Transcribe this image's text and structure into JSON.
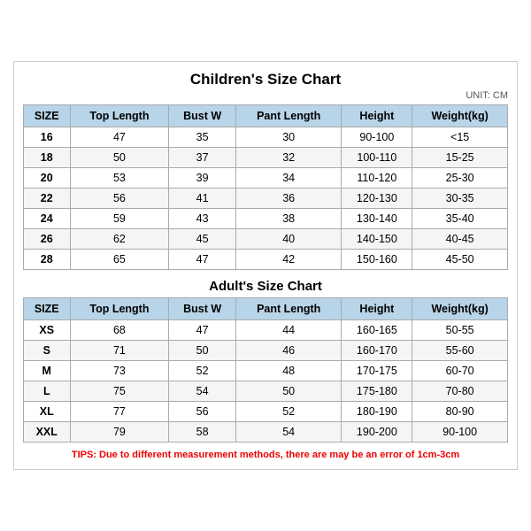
{
  "main_title": "Children's Size Chart",
  "unit": "UNIT: CM",
  "children_headers": [
    "SIZE",
    "Top Length",
    "Bust W",
    "Pant Length",
    "Height",
    "Weight(kg)"
  ],
  "children_rows": [
    [
      "16",
      "47",
      "35",
      "30",
      "90-100",
      "<15"
    ],
    [
      "18",
      "50",
      "37",
      "32",
      "100-110",
      "15-25"
    ],
    [
      "20",
      "53",
      "39",
      "34",
      "110-120",
      "25-30"
    ],
    [
      "22",
      "56",
      "41",
      "36",
      "120-130",
      "30-35"
    ],
    [
      "24",
      "59",
      "43",
      "38",
      "130-140",
      "35-40"
    ],
    [
      "26",
      "62",
      "45",
      "40",
      "140-150",
      "40-45"
    ],
    [
      "28",
      "65",
      "47",
      "42",
      "150-160",
      "45-50"
    ]
  ],
  "adult_title": "Adult's Size Chart",
  "adult_headers": [
    "SIZE",
    "Top Length",
    "Bust W",
    "Pant Length",
    "Height",
    "Weight(kg)"
  ],
  "adult_rows": [
    [
      "XS",
      "68",
      "47",
      "44",
      "160-165",
      "50-55"
    ],
    [
      "S",
      "71",
      "50",
      "46",
      "160-170",
      "55-60"
    ],
    [
      "M",
      "73",
      "52",
      "48",
      "170-175",
      "60-70"
    ],
    [
      "L",
      "75",
      "54",
      "50",
      "175-180",
      "70-80"
    ],
    [
      "XL",
      "77",
      "56",
      "52",
      "180-190",
      "80-90"
    ],
    [
      "XXL",
      "79",
      "58",
      "54",
      "190-200",
      "90-100"
    ]
  ],
  "tips": "TIPS: Due to different measurement methods, there are may be an error of 1cm-3cm"
}
